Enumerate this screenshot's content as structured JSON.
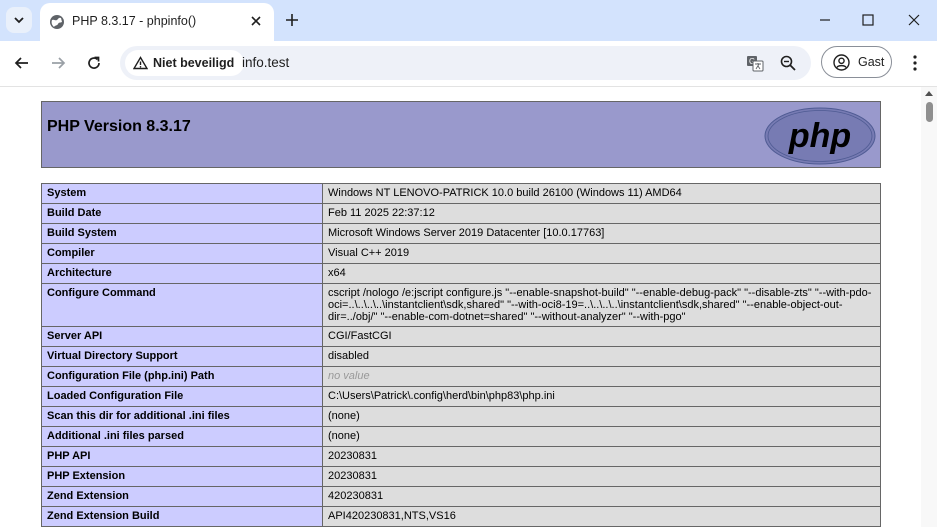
{
  "browser": {
    "tab_title": "PHP 8.3.17 - phpinfo()",
    "security_label": "Niet beveiligd",
    "url": "info.test",
    "profile_label": "Gast"
  },
  "page": {
    "heading": "PHP Version 8.3.17",
    "logo_text": "php",
    "rows": [
      {
        "key": "System",
        "value": "Windows NT LENOVO-PATRICK 10.0 build 26100 (Windows 11) AMD64"
      },
      {
        "key": "Build Date",
        "value": "Feb 11 2025 22:37:12"
      },
      {
        "key": "Build System",
        "value": "Microsoft Windows Server 2019 Datacenter [10.0.17763]"
      },
      {
        "key": "Compiler",
        "value": "Visual C++ 2019"
      },
      {
        "key": "Architecture",
        "value": "x64"
      },
      {
        "key": "Configure Command",
        "value": "cscript /nologo /e:jscript configure.js \"--enable-snapshot-build\" \"--enable-debug-pack\" \"--disable-zts\" \"--with-pdo-oci=..\\..\\..\\..\\instantclient\\sdk,shared\" \"--with-oci8-19=..\\..\\..\\..\\instantclient\\sdk,shared\" \"--enable-object-out-dir=../obj/\" \"--enable-com-dotnet=shared\" \"--without-analyzer\" \"--with-pgo\""
      },
      {
        "key": "Server API",
        "value": "CGI/FastCGI"
      },
      {
        "key": "Virtual Directory Support",
        "value": "disabled"
      },
      {
        "key": "Configuration File (php.ini) Path",
        "value": "no value"
      },
      {
        "key": "Loaded Configuration File",
        "value": "C:\\Users\\Patrick\\.config\\herd\\bin\\php83\\php.ini"
      },
      {
        "key": "Scan this dir for additional .ini files",
        "value": "(none)"
      },
      {
        "key": "Additional .ini files parsed",
        "value": "(none)"
      },
      {
        "key": "PHP API",
        "value": "20230831"
      },
      {
        "key": "PHP Extension",
        "value": "20230831"
      },
      {
        "key": "Zend Extension",
        "value": "420230831"
      },
      {
        "key": "Zend Extension Build",
        "value": "API420230831,NTS,VS16"
      }
    ]
  },
  "colors": {
    "header_bg": "#9999cc",
    "key_bg": "#ccccff",
    "value_bg": "#dddddd",
    "chrome_bg": "#d3e3fd"
  }
}
